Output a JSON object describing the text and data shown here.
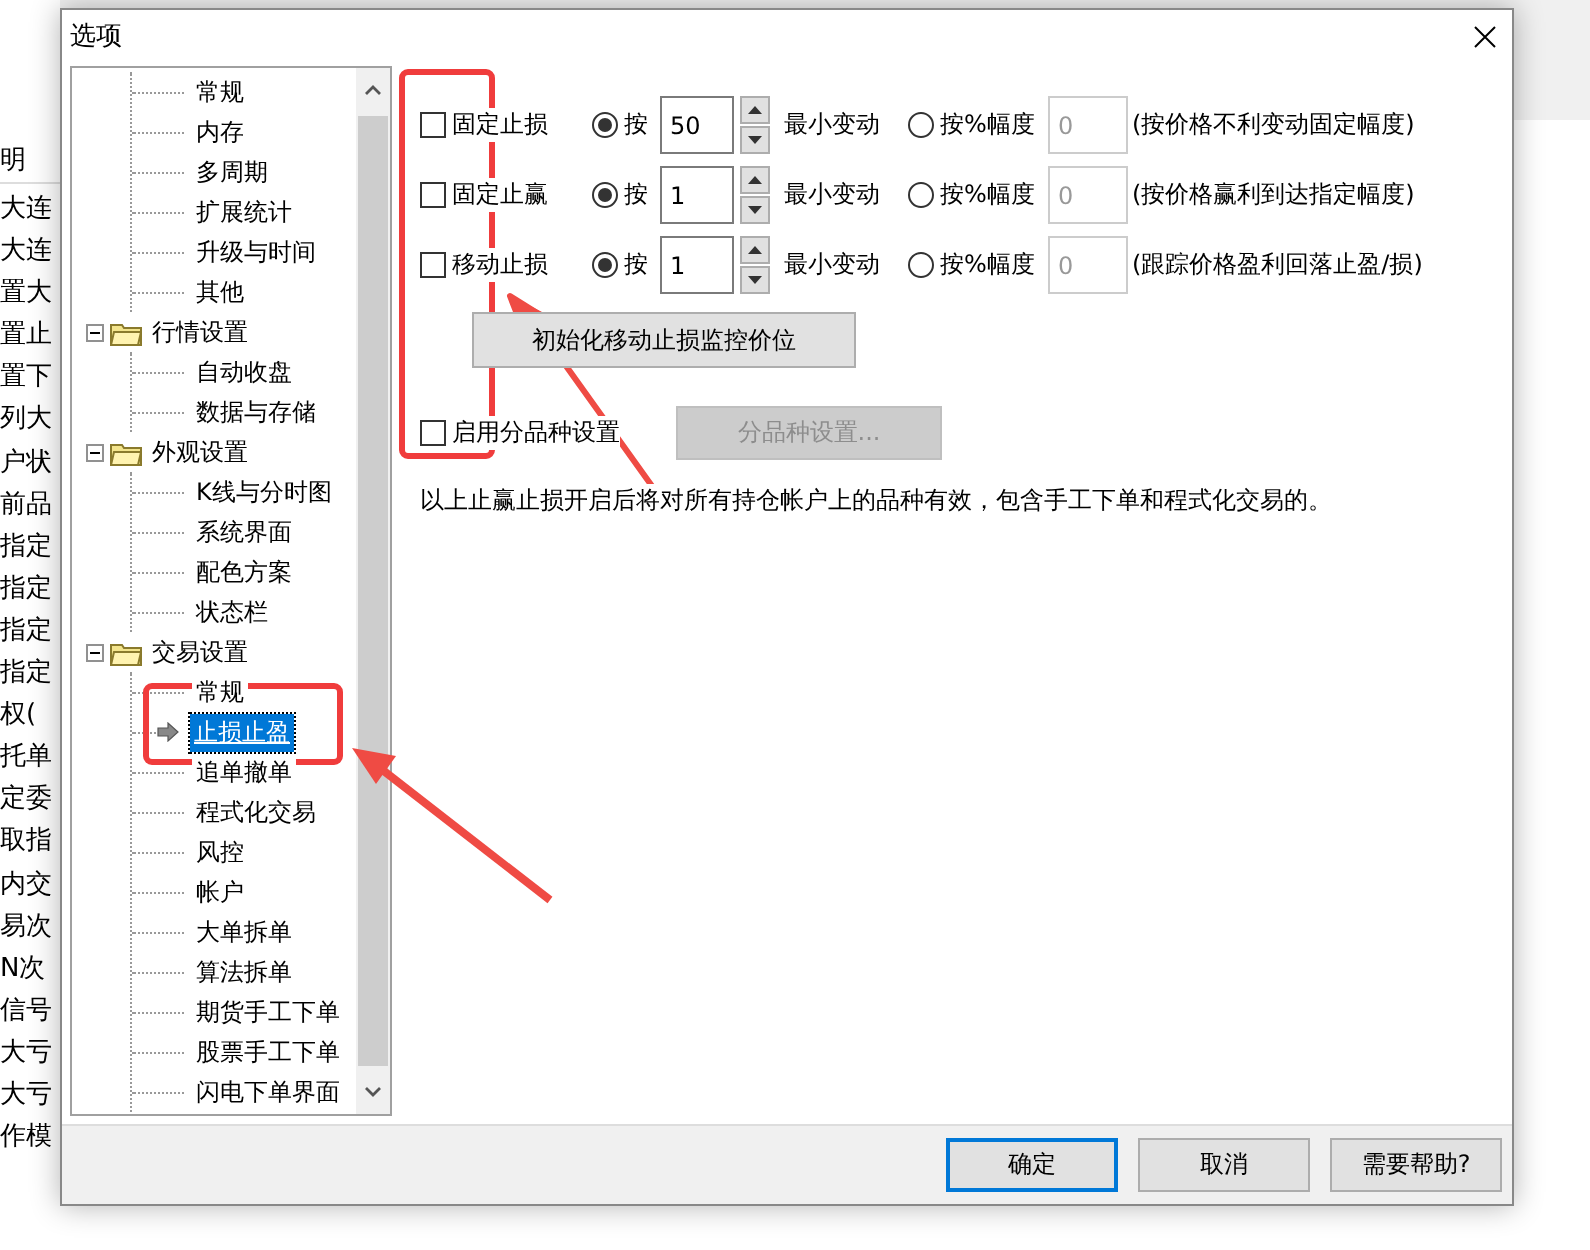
{
  "window": {
    "title": "选项"
  },
  "background_list": {
    "header": "明",
    "rows": [
      "大连",
      "大连",
      "置大",
      "置止",
      "置下",
      "列大",
      "户状",
      "前品",
      "指定",
      "指定",
      "指定",
      "指定",
      "权(",
      "托单",
      "定委",
      "取指",
      "内交",
      "易次",
      "N次",
      "信号",
      "大亏",
      "大亏",
      "作模"
    ]
  },
  "tree": {
    "groups": [
      {
        "expanded": true,
        "children": [
          {
            "label": "常规",
            "selected": false
          },
          {
            "label": "内存",
            "selected": false
          },
          {
            "label": "多周期",
            "selected": false
          },
          {
            "label": "扩展统计",
            "selected": false
          },
          {
            "label": "升级与时间",
            "selected": false
          },
          {
            "label": "其他",
            "selected": false
          }
        ]
      },
      {
        "label": "行情设置",
        "expanded": true,
        "children": [
          {
            "label": "自动收盘",
            "selected": false
          },
          {
            "label": "数据与存储",
            "selected": false
          }
        ]
      },
      {
        "label": "外观设置",
        "expanded": true,
        "children": [
          {
            "label": "K线与分时图",
            "selected": false
          },
          {
            "label": "系统界面",
            "selected": false
          },
          {
            "label": "配色方案",
            "selected": false
          },
          {
            "label": "状态栏",
            "selected": false
          }
        ]
      },
      {
        "label": "交易设置",
        "expanded": true,
        "children": [
          {
            "label": "常规",
            "selected": false
          },
          {
            "label": "止损止盈",
            "selected": true
          },
          {
            "label": "追单撤单",
            "selected": false
          },
          {
            "label": "程式化交易",
            "selected": false
          },
          {
            "label": "风控",
            "selected": false
          },
          {
            "label": "帐户",
            "selected": false
          },
          {
            "label": "大单拆单",
            "selected": false
          },
          {
            "label": "算法拆单",
            "selected": false
          },
          {
            "label": "期货手工下单",
            "selected": false
          },
          {
            "label": "股票手工下单",
            "selected": false
          },
          {
            "label": "闪电下单界面",
            "selected": false
          }
        ]
      }
    ]
  },
  "stop_rules": [
    {
      "label": "固定止损",
      "checked": false,
      "by_tick": {
        "label": "按",
        "selected": true
      },
      "value": "50",
      "unit": "最小变动",
      "by_percent": {
        "label": "按%幅度",
        "selected": false
      },
      "percent_value": "0",
      "percent_disabled": true,
      "note": "(按价格不利变动固定幅度)"
    },
    {
      "label": "固定止赢",
      "checked": false,
      "by_tick": {
        "label": "按",
        "selected": true
      },
      "value": "1",
      "unit": "最小变动",
      "by_percent": {
        "label": "按%幅度",
        "selected": false
      },
      "percent_value": "0",
      "percent_disabled": true,
      "note": "(按价格赢利到达指定幅度)"
    },
    {
      "label": "移动止损",
      "checked": false,
      "by_tick": {
        "label": "按",
        "selected": true
      },
      "value": "1",
      "unit": "最小变动",
      "by_percent": {
        "label": "按%幅度",
        "selected": false
      },
      "percent_value": "0",
      "percent_disabled": true,
      "note": "(跟踪价格盈利回落止盈/损)"
    }
  ],
  "init_button": {
    "label": "初始化移动止损监控价位",
    "disabled": false
  },
  "per_symbol": {
    "label": "启用分品种设置",
    "checked": false
  },
  "per_symbol_button": {
    "label": "分品种设置...",
    "disabled": true
  },
  "note": "以上止赢止损开启后将对所有持仓帐户上的品种有效，包含手工下单和程式化交易的。",
  "buttons": [
    {
      "label": "确定",
      "default": true
    },
    {
      "label": "取消",
      "default": false
    },
    {
      "label": "需要帮助?",
      "default": false
    }
  ]
}
